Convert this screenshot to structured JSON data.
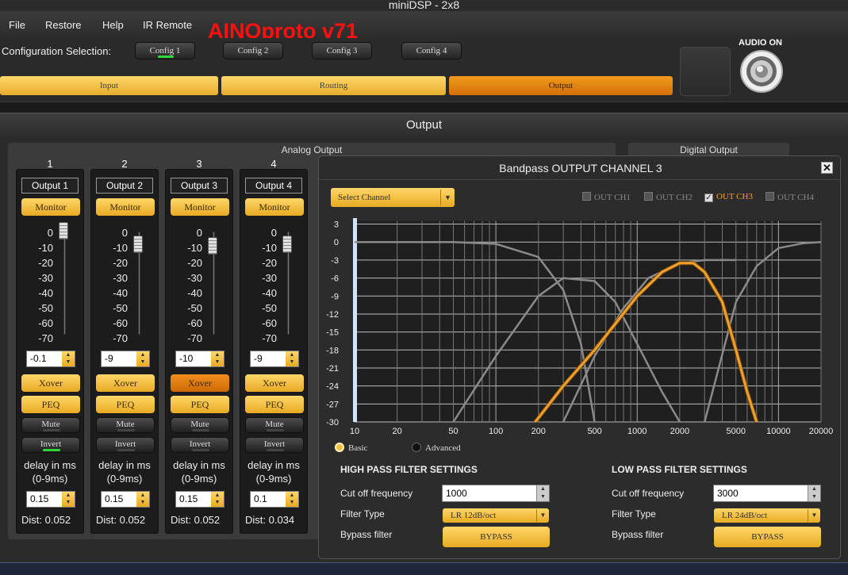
{
  "window": {
    "title": "miniDSP - 2x8",
    "brand": "AINOproto v71"
  },
  "menu": [
    "File",
    "Restore",
    "Help",
    "IR Remote"
  ],
  "config": {
    "label": "Configuration Selection:",
    "buttons": [
      "Config 1",
      "Config 2",
      "Config 3",
      "Config 4"
    ],
    "active_index": 0
  },
  "tabs": {
    "input": "Input",
    "routing": "Routing",
    "output": "Output",
    "active": "output"
  },
  "audio": {
    "label": "AUDIO ON"
  },
  "section": {
    "title": "Output",
    "analog_title": "Analog Output",
    "digital_title": "Digital Output"
  },
  "fader_scale": [
    "0",
    "-10",
    "-20",
    "-30",
    "-40",
    "-50",
    "-60",
    "-70"
  ],
  "channels": [
    {
      "number": "1",
      "name": "Output 1",
      "monitor": "Monitor",
      "gain": "-0.1",
      "gain_db": -0.1,
      "xover": "Xover",
      "peq": "PEQ",
      "mute": "Mute",
      "invert": "Invert",
      "delay_label": "delay in ms",
      "delay_range": "(0-9ms)",
      "delay": "0.15",
      "dist": "Dist: 0.052"
    },
    {
      "number": "2",
      "name": "Output 2",
      "monitor": "Monitor",
      "gain": "-9",
      "gain_db": -9,
      "xover": "Xover",
      "peq": "PEQ",
      "mute": "Mute",
      "invert": "Invert",
      "delay_label": "delay in ms",
      "delay_range": "(0-9ms)",
      "delay": "0.15",
      "dist": "Dist: 0.052"
    },
    {
      "number": "3",
      "name": "Output 3",
      "monitor": "Monitor",
      "gain": "-10",
      "gain_db": -10,
      "xover": "Xover",
      "peq": "PEQ",
      "mute": "Mute",
      "invert": "Invert",
      "delay_label": "delay in ms",
      "delay_range": "(0-9ms)",
      "delay": "0.15",
      "dist": "Dist: 0.052"
    },
    {
      "number": "4",
      "name": "Output 4",
      "monitor": "Monitor",
      "gain": "-9",
      "gain_db": -9,
      "xover": "Xover",
      "peq": "PEQ",
      "mute": "Mute",
      "invert": "Invert",
      "delay_label": "delay in ms",
      "delay_range": "(0-9ms)",
      "delay": "0.1",
      "dist": "Dist: 0.034"
    }
  ],
  "colors": {
    "accent_yellow": "#f2c040",
    "accent_orange": "#e8860c",
    "curve_active": "#f0a030",
    "curve_inactive": "#8a8a8a",
    "led_green": "#2fd63a"
  },
  "dialog": {
    "title": "Bandpass OUTPUT CHANNEL 3",
    "close_icon": "close-icon",
    "select_channel": "Select Channel",
    "checkboxes": [
      {
        "label": "OUT CH1",
        "checked": false
      },
      {
        "label": "OUT CH2",
        "checked": false
      },
      {
        "label": "OUT CH3",
        "checked": true
      },
      {
        "label": "OUT CH4",
        "checked": false
      }
    ],
    "mode_basic": "Basic",
    "mode_advanced": "Advanced",
    "mode_selected": "Basic",
    "high_pass": {
      "title": "HIGH PASS FILTER SETTINGS",
      "cutoff_label": "Cut off frequency",
      "cutoff": "1000",
      "type_label": "Filter Type",
      "type": "LR 12dB/oct",
      "bypass_label": "Bypass filter",
      "bypass_button": "BYPASS"
    },
    "low_pass": {
      "title": "LOW PASS FILTER SETTINGS",
      "cutoff_label": "Cut off frequency",
      "cutoff": "3000",
      "type_label": "Filter Type",
      "type": "LR 24dB/oct",
      "bypass_label": "Bypass filter",
      "bypass_button": "BYPASS"
    }
  },
  "chart_data": {
    "type": "line",
    "x_scale": "log",
    "xlim": [
      10,
      20000
    ],
    "ylim": [
      -30,
      4
    ],
    "x_ticks": [
      10,
      20,
      50,
      100,
      200,
      500,
      1000,
      2000,
      5000,
      10000,
      20000
    ],
    "y_ticks": [
      3,
      0,
      -3,
      -6,
      -9,
      -12,
      -15,
      -18,
      -21,
      -24,
      -27,
      -30
    ],
    "grid": true,
    "series": [
      {
        "active": false,
        "x": [
          10,
          50,
          100,
          200,
          300,
          400,
          500
        ],
        "y": [
          0,
          0,
          -0.3,
          -2.5,
          -8,
          -17,
          -30
        ]
      },
      {
        "active": false,
        "x": [
          50,
          100,
          200,
          300,
          500,
          700,
          1000,
          1500,
          2000
        ],
        "y": [
          -30,
          -19,
          -9,
          -6,
          -6.5,
          -10,
          -17,
          -25,
          -30
        ]
      },
      {
        "active": false,
        "x": [
          300,
          500,
          800,
          1200,
          2000,
          3000,
          5000
        ],
        "y": [
          -30,
          -19,
          -11,
          -6,
          -3.5,
          -3,
          -3
        ]
      },
      {
        "active": false,
        "x": [
          3000,
          5000,
          7000,
          10000,
          15000,
          20000
        ],
        "y": [
          -30,
          -10,
          -4,
          -1,
          -0.2,
          0
        ]
      },
      {
        "active": true,
        "x": [
          190,
          300,
          500,
          1000,
          1500,
          2000,
          2500,
          3000,
          4000,
          5000,
          6000,
          7000
        ],
        "y": [
          -30,
          -24,
          -18,
          -9,
          -5,
          -3.5,
          -3.5,
          -5,
          -10,
          -18,
          -25,
          -30
        ]
      }
    ]
  }
}
